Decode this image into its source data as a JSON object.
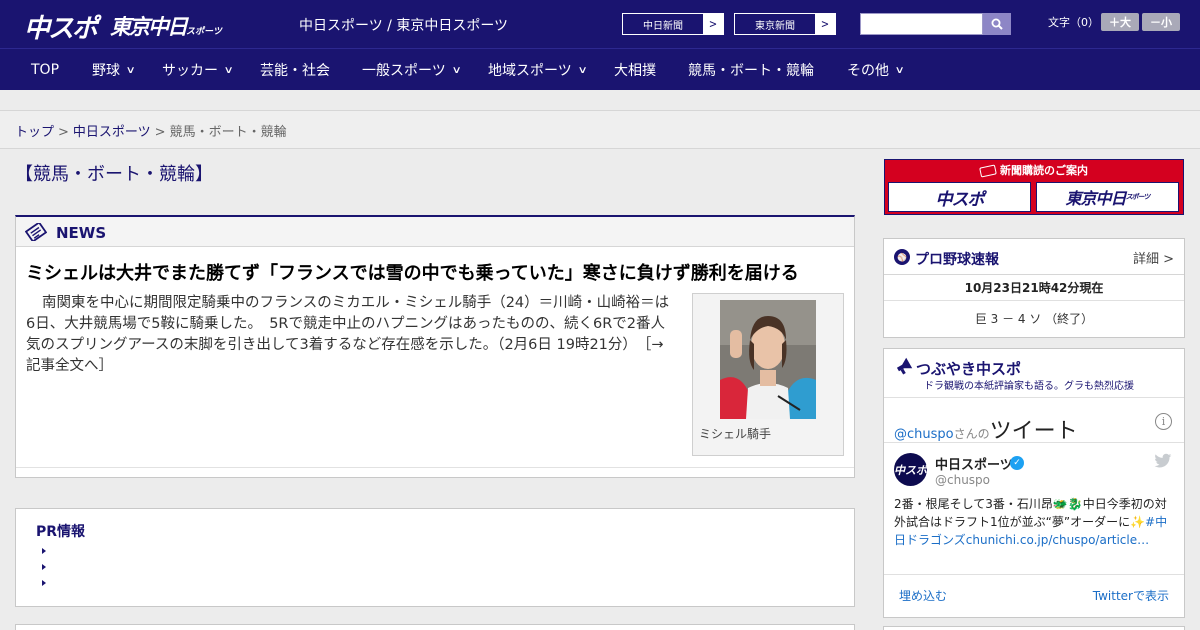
{
  "header": {
    "logo_chuspo": "中スポ",
    "logo_tokyo": "東京中日",
    "logo_tokyo_suffix": "スポーツ",
    "site_title": "中日スポーツ / 東京中日スポーツ",
    "paper_links": [
      "中日新聞",
      "東京新聞"
    ],
    "search": {
      "value": "",
      "placeholder": "",
      "icon": "search-icon"
    },
    "font_size": {
      "label": "文字（0）",
      "increase": "＋大",
      "decrease": "－小"
    }
  },
  "nav": [
    {
      "label": "TOP",
      "dropdown": false
    },
    {
      "label": "野球",
      "dropdown": true
    },
    {
      "label": "サッカー",
      "dropdown": true
    },
    {
      "label": "芸能・社会",
      "dropdown": false
    },
    {
      "label": "一般スポーツ",
      "dropdown": true
    },
    {
      "label": "地域スポーツ",
      "dropdown": true
    },
    {
      "label": "大相撲",
      "dropdown": false
    },
    {
      "label": "競馬・ボート・競輪",
      "dropdown": false
    },
    {
      "label": "その他",
      "dropdown": true
    }
  ],
  "breadcrumb": {
    "items": [
      "トップ",
      "中日スポーツ"
    ],
    "current": "競馬・ボート・競輪",
    "separator": ">"
  },
  "page_title": "【競馬・ボート・競輪】",
  "news": {
    "section_label": "NEWS",
    "headline": "ミシェルは大井でまた勝てず「フランスでは雪の中でも乗っていた」寒さに負けず勝利を届ける",
    "body": "南関東を中心に期間限定騎乗中のフランスのミカエル・ミシェル騎手（24）＝川崎・山崎裕＝は6日、大井競馬場で5鞍に騎乗した。　5Rで競走中止のハプニングはあったものの、続く6Rで2番人気のスプリングアースの末脚を引き出して3着するなど存在感を示した。（2月6日 19時21分）",
    "read_more": "［→記事全文へ］",
    "photo_caption": "ミシェル騎手"
  },
  "pr": {
    "title": "PR情報",
    "items": [
      "",
      "",
      ""
    ]
  },
  "subscribe_banner": {
    "title": "新聞購読のご案内",
    "logos": [
      "中スポ",
      "東京中日"
    ],
    "logo_suffix": "スポーツ"
  },
  "baseball": {
    "title": "プロ野球速報",
    "more": "詳細 >",
    "updated": "10月23日21時42分現在",
    "games": [
      "巨 3 － 4 ソ （終了）"
    ]
  },
  "tweets": {
    "title": "つぶやき中スポ",
    "subtitle": "ドラ観戦の本紙評論家も語る。グラも熱烈応援",
    "handle": "@chuspo",
    "handle_suffix": "さんの",
    "header_big": "ツイート",
    "account_name": "中日スポーツ",
    "account_at": "@chuspo",
    "avatar_text": "中スポ",
    "text": "2番・根尾そして3番・石川昂🐲🐉中日今季初の対外試合はドラフト1位が並ぶ“夢”オーダーに✨",
    "hashtag": "#中日ドラゴンズ",
    "link": "chunichi.co.jp/chuspo/article…",
    "embed_label": "埋め込む",
    "view_label": "Twitterで表示"
  },
  "colors": {
    "brand_navy": "#1a1470",
    "subscribe_red": "#d4001f",
    "link_blue": "#1b6ec7"
  }
}
